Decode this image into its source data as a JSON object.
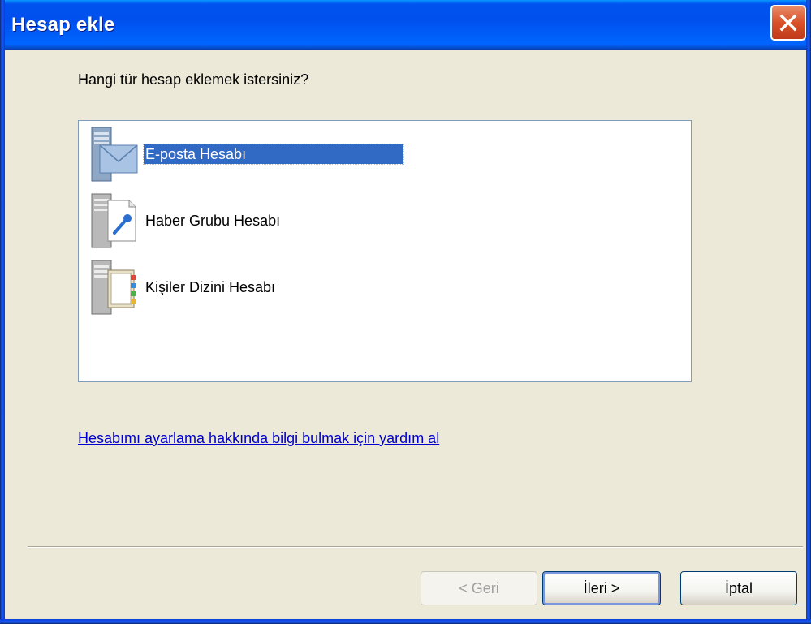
{
  "window": {
    "title": "Hesap ekle",
    "close_label": "Kapat"
  },
  "dialog": {
    "question": "Hangi tür hesap eklemek istersiniz?",
    "items": [
      {
        "label": "E-posta Hesabı",
        "icon": "email-account-icon",
        "selected": true
      },
      {
        "label": "Haber Grubu Hesabı",
        "icon": "newsgroup-account-icon",
        "selected": false
      },
      {
        "label": "Kişiler Dizini Hesabı",
        "icon": "directory-account-icon",
        "selected": false
      }
    ],
    "help_link": "Hesabımı ayarlama hakkında bilgi bulmak için yardım al"
  },
  "buttons": {
    "back": "< Geri",
    "next": "İleri >",
    "cancel": "İptal"
  },
  "colors": {
    "titlebar": "#0055ea",
    "selection": "#316ac5",
    "link": "#0000cc",
    "dialog_bg": "#ece9d8"
  }
}
